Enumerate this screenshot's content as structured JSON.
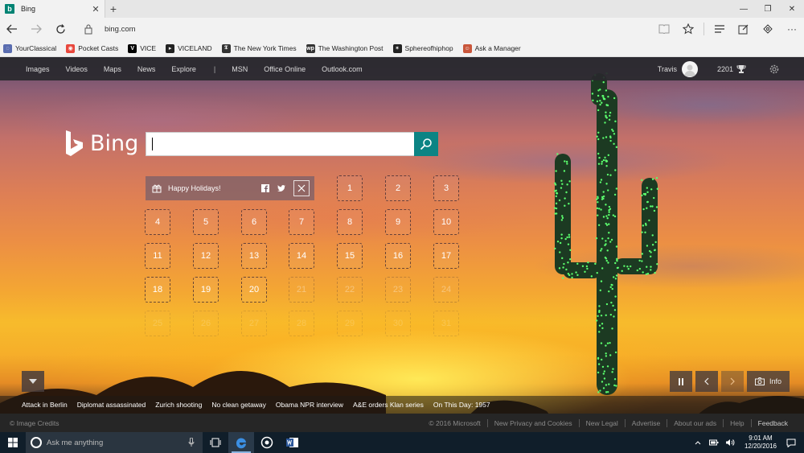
{
  "browser": {
    "tab_title": "Bing",
    "url": "bing.com",
    "favorites": [
      {
        "label": "YourClassical",
        "color": "#5a6db0"
      },
      {
        "label": "Pocket Casts",
        "color": "#e8473c"
      },
      {
        "label": "VICE",
        "color": "#000000"
      },
      {
        "label": "VICELAND",
        "color": "#222222"
      },
      {
        "label": "The New York Times",
        "color": "#333333"
      },
      {
        "label": "The Washington Post",
        "color": "#333333"
      },
      {
        "label": "Sphereofhiphop",
        "color": "#222222"
      },
      {
        "label": "Ask a Manager",
        "color": "#c9563b"
      }
    ]
  },
  "bing": {
    "nav": [
      "Images",
      "Videos",
      "Maps",
      "News",
      "Explore"
    ],
    "nav_right": [
      "MSN",
      "Office Online",
      "Outlook.com"
    ],
    "user_name": "Travis",
    "rewards": "2201",
    "logo_text": "Bing",
    "search_value": "",
    "holiday_text": "Happy Holidays!",
    "calendar": [
      {
        "n": "1",
        "state": "open"
      },
      {
        "n": "2",
        "state": "open"
      },
      {
        "n": "3",
        "state": "open"
      },
      {
        "n": "4",
        "state": "open"
      },
      {
        "n": "5",
        "state": "open"
      },
      {
        "n": "6",
        "state": "open"
      },
      {
        "n": "7",
        "state": "open"
      },
      {
        "n": "8",
        "state": "open"
      },
      {
        "n": "9",
        "state": "open"
      },
      {
        "n": "10",
        "state": "open"
      },
      {
        "n": "11",
        "state": "open"
      },
      {
        "n": "12",
        "state": "open"
      },
      {
        "n": "13",
        "state": "open"
      },
      {
        "n": "14",
        "state": "open"
      },
      {
        "n": "15",
        "state": "open"
      },
      {
        "n": "16",
        "state": "open"
      },
      {
        "n": "17",
        "state": "open"
      },
      {
        "n": "18",
        "state": "open"
      },
      {
        "n": "19",
        "state": "open"
      },
      {
        "n": "20",
        "state": "open"
      },
      {
        "n": "21",
        "state": "future"
      },
      {
        "n": "22",
        "state": "future"
      },
      {
        "n": "23",
        "state": "future"
      },
      {
        "n": "24",
        "state": "future"
      },
      {
        "n": "25",
        "state": "far"
      },
      {
        "n": "26",
        "state": "far"
      },
      {
        "n": "27",
        "state": "far"
      },
      {
        "n": "28",
        "state": "far"
      },
      {
        "n": "29",
        "state": "far"
      },
      {
        "n": "30",
        "state": "far"
      },
      {
        "n": "31",
        "state": "far"
      }
    ],
    "info_label": "Info",
    "news": [
      "Attack in Berlin",
      "Diplomat assassinated",
      "Zurich shooting",
      "No clean getaway",
      "Obama NPR interview",
      "A&E orders Klan series",
      "On This Day: 1957"
    ],
    "footer_left": "© Image Credits",
    "footer_links": [
      "© 2016 Microsoft",
      "New Privacy and Cookies",
      "New Legal",
      "Advertise",
      "About our ads",
      "Help",
      "Feedback"
    ]
  },
  "taskbar": {
    "search_placeholder": "Ask me anything",
    "time": "9:01 AM",
    "date": "12/20/2016"
  },
  "colors": {
    "bing_teal": "#0c8484",
    "taskbar": "#101e2a"
  }
}
